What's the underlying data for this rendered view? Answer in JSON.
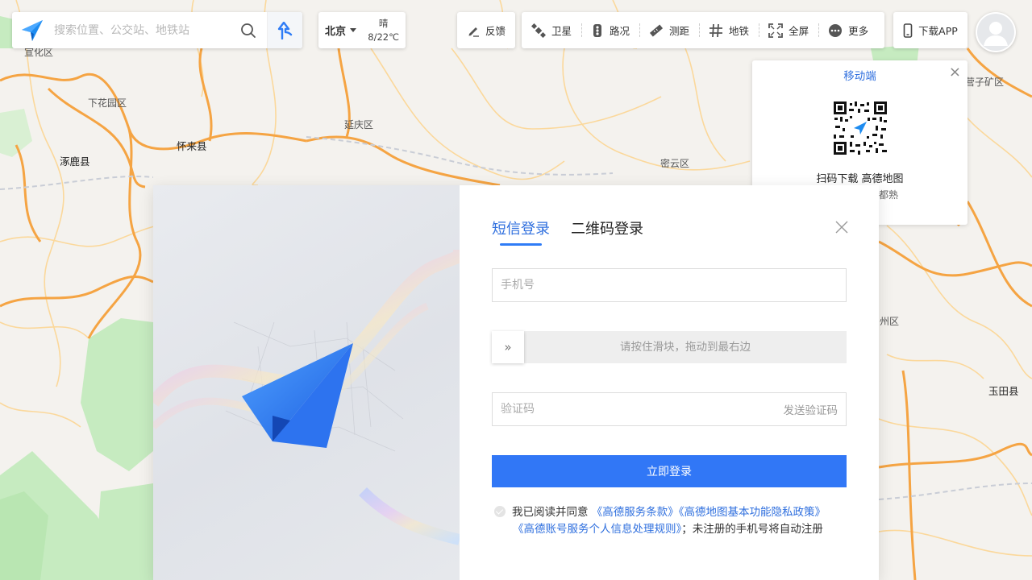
{
  "search": {
    "placeholder": "搜索位置、公交站、地铁站"
  },
  "city": {
    "name": "北京",
    "weather": "晴",
    "temperature": "8/22℃"
  },
  "toolbar": {
    "feedback": "反馈",
    "satellite": "卫星",
    "traffic": "路况",
    "measure": "测距",
    "subway": "地铁",
    "fullscreen": "全屏",
    "more": "更多",
    "download_app": "下载APP"
  },
  "map_labels": {
    "xuanhua": "宣化区",
    "xiahuayuan": "下花园区",
    "yanqing": "延庆区",
    "huailai": "怀来县",
    "zhuolu": "涿鹿县",
    "miyun": "密云区",
    "yingzi": "营子矿区",
    "yutian": "玉田县",
    "zhou": "州区"
  },
  "mobile_popup": {
    "title": "移动端",
    "caption": "扫码下载 高德地图",
    "sub": "都熟"
  },
  "login": {
    "tab_sms": "短信登录",
    "tab_qr": "二维码登录",
    "phone_placeholder": "手机号",
    "slider_text": "请按住滑块，拖动到最右边",
    "code_placeholder": "验证码",
    "send_code": "发送验证码",
    "submit": "立即登录",
    "agree_prefix": "我已阅读并同意",
    "terms": "《高德服务条款》",
    "privacy": "《高德地图基本功能隐私政策》",
    "account_rules": "《高德账号服务个人信息处理规则》",
    "agree_suffix": "；未注册的手机号将自动注册"
  },
  "colors": {
    "accent": "#3177f6",
    "link": "#2f6fde",
    "road_major": "#f5a443",
    "road_minor": "#fbd89b",
    "park": "#c6ebc0"
  }
}
